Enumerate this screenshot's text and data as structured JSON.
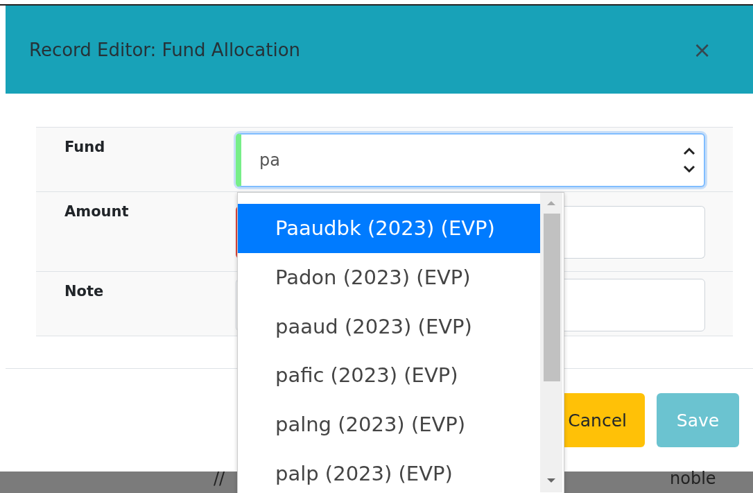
{
  "dialog": {
    "title": "Record Editor: Fund Allocation",
    "close": "×"
  },
  "fields": [
    {
      "label": "Fund",
      "kind": "select",
      "value": "pa"
    },
    {
      "label": "Amount",
      "kind": "input",
      "invalid": true
    },
    {
      "label": "Note",
      "kind": "input",
      "invalid": false
    }
  ],
  "dropdown": {
    "options": [
      {
        "label": "Paaudbk (2023) (EVP)",
        "selected": true
      },
      {
        "label": "Padon (2023) (EVP)",
        "selected": false
      },
      {
        "label": "paaud (2023) (EVP)",
        "selected": false
      },
      {
        "label": "pafic (2023) (EVP)",
        "selected": false
      },
      {
        "label": "palng (2023) (EVP)",
        "selected": false
      },
      {
        "label": "palp (2023) (EVP)",
        "selected": false
      }
    ]
  },
  "buttons": [
    {
      "label": "Cancel",
      "kind": "cancel"
    },
    {
      "label": "Save",
      "kind": "save"
    }
  ],
  "background": {
    "texts": [
      "//",
      "noble"
    ]
  }
}
